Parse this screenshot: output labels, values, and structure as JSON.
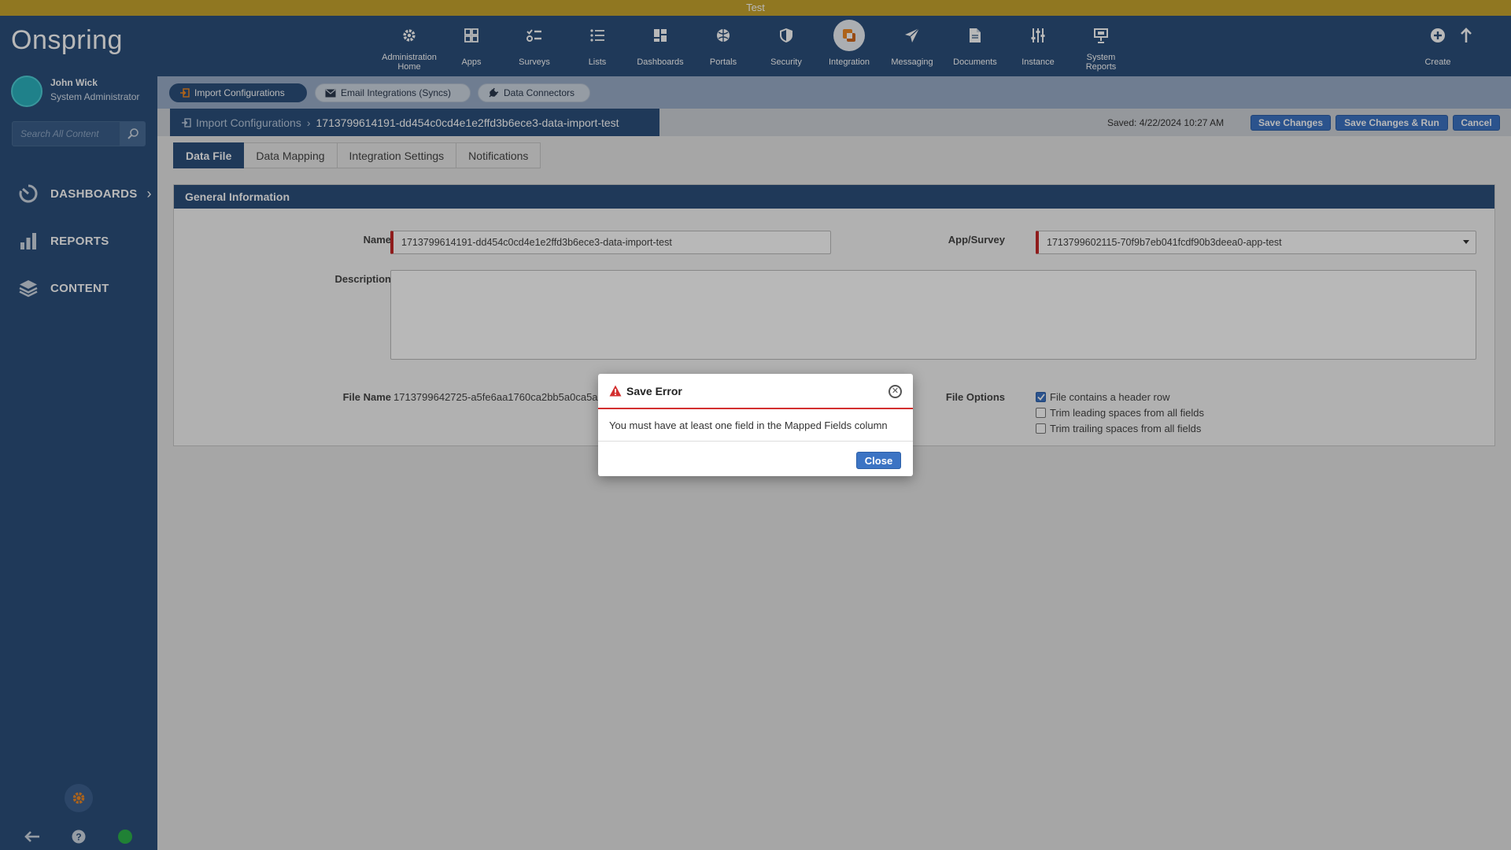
{
  "banner": {
    "text": "Test"
  },
  "brand": {
    "name": "Onspring"
  },
  "user": {
    "name": "John Wick",
    "role": "System Administrator"
  },
  "sidebar": {
    "search_placeholder": "Search All Content",
    "items": [
      {
        "label": "DASHBOARDS",
        "icon": "dashboard-gauge-icon"
      },
      {
        "label": "REPORTS",
        "icon": "bar-chart-icon"
      },
      {
        "label": "CONTENT",
        "icon": "layers-icon"
      }
    ]
  },
  "topnav": {
    "items": [
      {
        "label": "Administration\nHome",
        "icon": "gear-icon"
      },
      {
        "label": "Apps",
        "icon": "apps-grid-icon"
      },
      {
        "label": "Surveys",
        "icon": "survey-checklist-icon"
      },
      {
        "label": "Lists",
        "icon": "list-icon"
      },
      {
        "label": "Dashboards",
        "icon": "dashboard-tiles-icon"
      },
      {
        "label": "Portals",
        "icon": "portal-globe-icon"
      },
      {
        "label": "Security",
        "icon": "shield-icon"
      },
      {
        "label": "Integration",
        "icon": "integration-icon",
        "active": true
      },
      {
        "label": "Messaging",
        "icon": "paper-plane-icon"
      },
      {
        "label": "Documents",
        "icon": "document-icon"
      },
      {
        "label": "Instance",
        "icon": "sliders-icon"
      },
      {
        "label": "System\nReports",
        "icon": "presentation-icon"
      }
    ],
    "create_label": "Create"
  },
  "subbar": {
    "pills": [
      {
        "label": "Import Configurations",
        "icon": "import-icon",
        "active": true
      },
      {
        "label": "Email Integrations (Syncs)",
        "icon": "envelope-icon",
        "active": false
      },
      {
        "label": "Data Connectors",
        "icon": "plug-icon",
        "active": false
      }
    ]
  },
  "breadcrumb": {
    "parent": "Import Configurations",
    "current": "1713799614191-dd454c0cd4e1e2ffd3b6ece3-data-import-test"
  },
  "toolbar": {
    "saved": "Saved: 4/22/2024 10:27 AM",
    "save_label": "Save Changes",
    "save_run_label": "Save Changes & Run",
    "cancel_label": "Cancel"
  },
  "tabs": [
    {
      "label": "Data File",
      "active": true
    },
    {
      "label": "Data Mapping",
      "active": false
    },
    {
      "label": "Integration Settings",
      "active": false
    },
    {
      "label": "Notifications",
      "active": false
    }
  ],
  "general": {
    "title": "General Information",
    "name_label": "Name",
    "name_value": "1713799614191-dd454c0cd4e1e2ffd3b6ece3-data-import-test",
    "app_label": "App/Survey",
    "app_value": "1713799602115-70f9b7eb041fcdf90b3deea0-app-test",
    "description_label": "Description",
    "description_value": "",
    "filename_label": "File Name",
    "filename_value": "1713799642725-a5fe6aa1760ca2bb5a0ca5a",
    "file_options_label": "File Options",
    "options": [
      {
        "label": "File contains a header row",
        "checked": true
      },
      {
        "label": "Trim leading spaces from all fields",
        "checked": false
      },
      {
        "label": "Trim trailing spaces from all fields",
        "checked": false
      }
    ]
  },
  "dialog": {
    "title": "Save Error",
    "message": "You must have at least one field in the Mapped Fields column",
    "close_label": "Close"
  },
  "colors": {
    "navy": "#2b4f7c",
    "banner": "#c8a52e",
    "accent_blue": "#3c74c4",
    "error_red": "#d32f2f",
    "status_green": "#2db34a",
    "integration_orange": "#f08a24"
  }
}
